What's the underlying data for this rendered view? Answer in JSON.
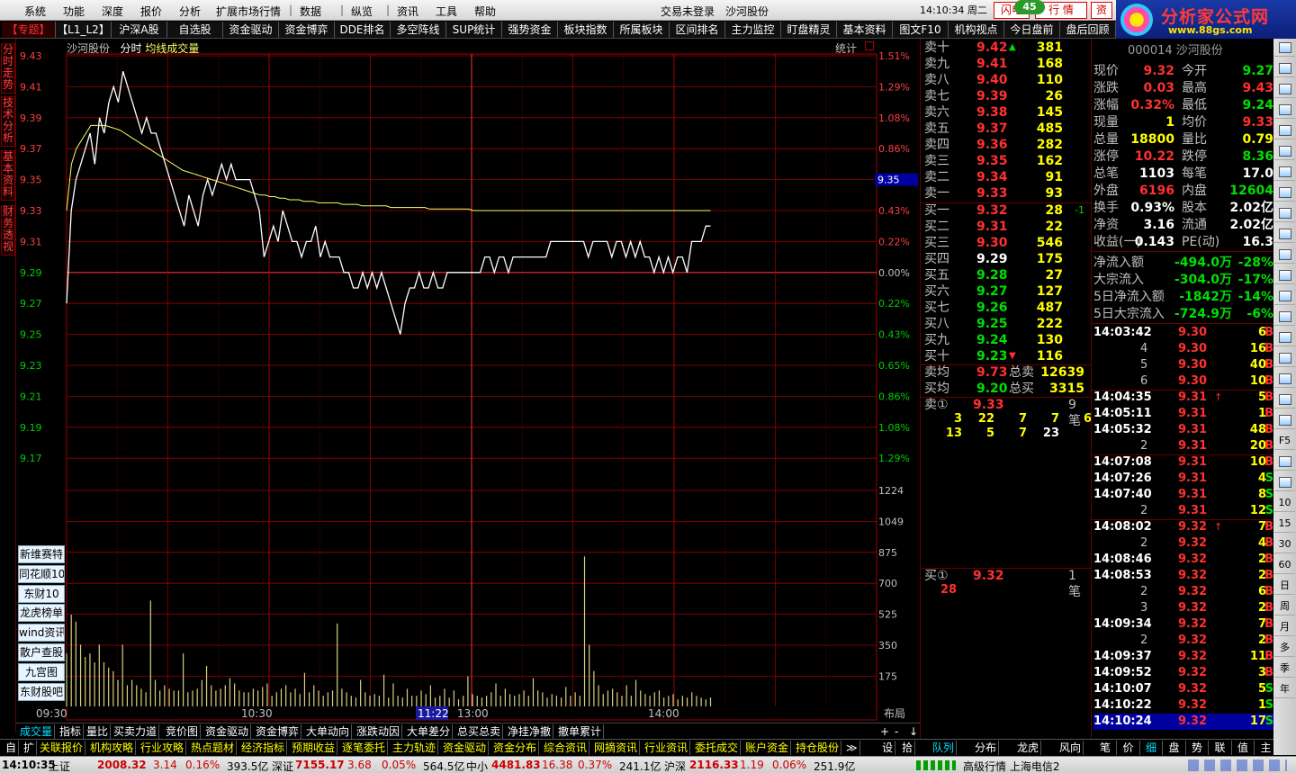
{
  "menu": [
    "系统",
    "功能",
    "深度",
    "报价",
    "分析",
    "扩展市场行情",
    "数据",
    "纵览",
    "资讯",
    "工具",
    "帮助"
  ],
  "menu_status": "交易未登录",
  "menu_stock": "沙河股份",
  "clock": "14:10:34 周二",
  "btn_flash": "闪电",
  "btn_quote": "行 情",
  "btn_capital": "资",
  "badge": "45",
  "logo_title": "分析家公式网",
  "logo_url": "www.88gs.com",
  "tabs": [
    "【专题】",
    "【L1_L2】",
    "沪深A股",
    "自选股",
    "资金驱动",
    "资金博弈",
    "DDE排名",
    "多空阵线",
    "SUP统计",
    "强势资金",
    "板块指数",
    "所属板块",
    "区间排名",
    "主力监控",
    "盯盘精灵",
    "基本资料",
    "图文F10",
    "机构视点",
    "今日盘前",
    "盘后回顾"
  ],
  "vtabs": [
    "分时走势",
    "技术分析",
    "基本资料",
    "财务透视"
  ],
  "chart": {
    "stock": "沙河股份",
    "tab_labels": "分时",
    "avg_label": "均线",
    "vol_label": "成交量",
    "stat_label": "统计",
    "price_labels": [
      "9.43",
      "9.41",
      "9.39",
      "9.37",
      "9.35",
      "9.33",
      "9.31",
      "9.29",
      "9.27",
      "9.25",
      "9.23",
      "9.21",
      "9.19",
      "9.17"
    ],
    "pct_labels": [
      "1.51%",
      "1.29%",
      "1.08%",
      "0.86%",
      "0.65%",
      "0.43%",
      "0.22%",
      "0.00%",
      "0.22%",
      "0.43%",
      "0.65%",
      "0.86%",
      "1.08%",
      "1.29%"
    ],
    "vol_labels": [
      "1224",
      "1049",
      "875",
      "700",
      "525",
      "350",
      "175"
    ],
    "current_price_tag": "9.35",
    "time_labels": [
      "09:30",
      "10:30",
      "11:22",
      "13:00",
      "14:00"
    ],
    "layout_label": "布局",
    "side_buttons": [
      "新维赛特",
      "同花顺10",
      "东财10",
      "龙虎榜单",
      "wind资讯",
      "散户查股",
      "九宫图",
      "东财股吧"
    ]
  },
  "chart_data": {
    "type": "line",
    "title": "沙河股份 分时",
    "prev_close": 9.29,
    "ylim": [
      9.16,
      9.44
    ],
    "x_range": [
      "09:30",
      "15:00"
    ],
    "series": [
      {
        "name": "price",
        "values": [
          9.27,
          9.33,
          9.35,
          9.36,
          9.37,
          9.38,
          9.36,
          9.39,
          9.38,
          9.4,
          9.41,
          9.4,
          9.42,
          9.41,
          9.4,
          9.39,
          9.38,
          9.39,
          9.38,
          9.38,
          9.37,
          9.36,
          9.35,
          9.34,
          9.33,
          9.32,
          9.34,
          9.33,
          9.32,
          9.34,
          9.35,
          9.34,
          9.35,
          9.36,
          9.35,
          9.36,
          9.35,
          9.35,
          9.35,
          9.35,
          9.34,
          9.33,
          9.3,
          9.31,
          9.32,
          9.31,
          9.33,
          9.32,
          9.31,
          9.31,
          9.3,
          9.31,
          9.31,
          9.32,
          9.3,
          9.31,
          9.3,
          9.3,
          9.3,
          9.29,
          9.29,
          9.28,
          9.28,
          9.29,
          9.28,
          9.29,
          9.28,
          9.29,
          9.28,
          9.27,
          9.26,
          9.25,
          9.27,
          9.28,
          9.28,
          9.29,
          9.28,
          9.28,
          9.29,
          9.28,
          9.28,
          9.29,
          9.29,
          9.29,
          9.29,
          9.29,
          9.29,
          9.29,
          9.29,
          9.3,
          9.3,
          9.29,
          9.3,
          9.3,
          9.29,
          9.3,
          9.3,
          9.3,
          9.3,
          9.3,
          9.3,
          9.3,
          9.3,
          9.31,
          9.31,
          9.31,
          9.31,
          9.31,
          9.31,
          9.31,
          9.31,
          9.3,
          9.31,
          9.31,
          9.31,
          9.31,
          9.3,
          9.31,
          9.31,
          9.3,
          9.31,
          9.3,
          9.31,
          9.3,
          9.3,
          9.29,
          9.3,
          9.29,
          9.3,
          9.29,
          9.3,
          9.3,
          9.29,
          9.31,
          9.31,
          9.31,
          9.32,
          9.32
        ]
      },
      {
        "name": "avg",
        "values": [
          9.33,
          9.36,
          9.37,
          9.375,
          9.38,
          9.385,
          9.385,
          9.385,
          9.385,
          9.384,
          9.383,
          9.382,
          9.38,
          9.378,
          9.376,
          9.374,
          9.372,
          9.37,
          9.368,
          9.366,
          9.364,
          9.362,
          9.36,
          9.358,
          9.356,
          9.355,
          9.354,
          9.353,
          9.352,
          9.351,
          9.35,
          9.349,
          9.348,
          9.347,
          9.346,
          9.345,
          9.344,
          9.343,
          9.342,
          9.341,
          9.34,
          9.34,
          9.339,
          9.339,
          9.338,
          9.338,
          9.337,
          9.337,
          9.337,
          9.336,
          9.336,
          9.336,
          9.335,
          9.335,
          9.335,
          9.335,
          9.335,
          9.334,
          9.334,
          9.334,
          9.334,
          9.333,
          9.333,
          9.333,
          9.333,
          9.333,
          9.333,
          9.332,
          9.332,
          9.332,
          9.332,
          9.332,
          9.332,
          9.332,
          9.332,
          9.331,
          9.331,
          9.331,
          9.331,
          9.331,
          9.331,
          9.331,
          9.331,
          9.331,
          9.33,
          9.33,
          9.33,
          9.33,
          9.33,
          9.33,
          9.33,
          9.33,
          9.33,
          9.33,
          9.33,
          9.33,
          9.33,
          9.33,
          9.33,
          9.33,
          9.33,
          9.33,
          9.33,
          9.33,
          9.33,
          9.33,
          9.33,
          9.33,
          9.33,
          9.33,
          9.33,
          9.33,
          9.33,
          9.33,
          9.33,
          9.33,
          9.33,
          9.33,
          9.33,
          9.33,
          9.33,
          9.33,
          9.33,
          9.33,
          9.33,
          9.33,
          9.33,
          9.33,
          9.33,
          9.33,
          9.33,
          9.33,
          9.33,
          9.33
        ]
      },
      {
        "name": "volume",
        "values": [
          300,
          520,
          480,
          350,
          280,
          300,
          250,
          350,
          250,
          220,
          200,
          150,
          350,
          120,
          150,
          120,
          100,
          80,
          600,
          150,
          90,
          120,
          100,
          90,
          90,
          300,
          80,
          90,
          100,
          150,
          230,
          120,
          90,
          100,
          120,
          160,
          130,
          90,
          80,
          80,
          100,
          90,
          110,
          130,
          60,
          80,
          100,
          120,
          80,
          100,
          70,
          190,
          80,
          120,
          90,
          60,
          80,
          90,
          470,
          100,
          80,
          60,
          50,
          150,
          80,
          60,
          70,
          60,
          180,
          50,
          130,
          60,
          50,
          100,
          60,
          60,
          90,
          70,
          120,
          50,
          60,
          100,
          50,
          90,
          40,
          60,
          170,
          70,
          60,
          50,
          60,
          80,
          130,
          60,
          100,
          70,
          60,
          70,
          90,
          60,
          160,
          90,
          80,
          50,
          70,
          60,
          50,
          110,
          60,
          80,
          60,
          850,
          350,
          200,
          120,
          70,
          90,
          100,
          80,
          60,
          120,
          60,
          150,
          90,
          70,
          60,
          80,
          90,
          50,
          60,
          70,
          40,
          60,
          50,
          80,
          60,
          50,
          40,
          50
        ]
      }
    ]
  },
  "orderbook": {
    "asks": [
      {
        "label": "卖十",
        "price": "9.42",
        "arrow": "▲",
        "vol": "381"
      },
      {
        "label": "卖九",
        "price": "9.41",
        "vol": "168"
      },
      {
        "label": "卖八",
        "price": "9.40",
        "vol": "110"
      },
      {
        "label": "卖七",
        "price": "9.39",
        "vol": "26"
      },
      {
        "label": "卖六",
        "price": "9.38",
        "vol": "145"
      },
      {
        "label": "卖五",
        "price": "9.37",
        "vol": "485"
      },
      {
        "label": "卖四",
        "price": "9.36",
        "vol": "282"
      },
      {
        "label": "卖三",
        "price": "9.35",
        "vol": "162"
      },
      {
        "label": "卖二",
        "price": "9.34",
        "vol": "91"
      },
      {
        "label": "卖一",
        "price": "9.33",
        "vol": "93"
      }
    ],
    "bids": [
      {
        "label": "买一",
        "price": "9.32",
        "vol": "28",
        "chg": "-1",
        "color": "red"
      },
      {
        "label": "买二",
        "price": "9.31",
        "vol": "22",
        "color": "red"
      },
      {
        "label": "买三",
        "price": "9.30",
        "vol": "546",
        "color": "red"
      },
      {
        "label": "买四",
        "price": "9.29",
        "vol": "175",
        "color": "white"
      },
      {
        "label": "买五",
        "price": "9.28",
        "vol": "27",
        "color": "green"
      },
      {
        "label": "买六",
        "price": "9.27",
        "vol": "127",
        "color": "green"
      },
      {
        "label": "买七",
        "price": "9.26",
        "vol": "487",
        "color": "green"
      },
      {
        "label": "买八",
        "price": "9.25",
        "vol": "222",
        "color": "green"
      },
      {
        "label": "买九",
        "price": "9.24",
        "vol": "130",
        "color": "green"
      },
      {
        "label": "买十",
        "price": "9.23",
        "arrow": "▼",
        "vol": "116",
        "color": "green"
      }
    ],
    "ask_avg_label": "卖均",
    "ask_avg": "9.73",
    "total_ask_label": "总卖",
    "total_ask": "12639",
    "bid_avg_label": "买均",
    "bid_avg": "9.20",
    "total_bid_label": "总买",
    "total_bid": "3315",
    "sell1_label": "卖①",
    "sell1_price": "9.33",
    "sell1_count": "9笔",
    "sell1_queue": [
      [
        "3",
        "22",
        "7",
        "7",
        "6"
      ],
      [
        "13",
        "5",
        "7",
        "23",
        ""
      ]
    ],
    "buy1_label": "买①",
    "buy1_price": "9.32",
    "buy1_count": "1笔",
    "buy1_queue": [
      "28"
    ],
    "bottom_tabs": [
      "队列",
      "分布",
      "龙虎",
      "风向"
    ]
  },
  "quote": {
    "code_name": "000014 沙河股份",
    "rows": [
      {
        "l1": "现价",
        "v1": "9.32",
        "c1": "red",
        "l2": "今开",
        "v2": "9.27",
        "c2": "green"
      },
      {
        "l1": "涨跌",
        "v1": "0.03",
        "c1": "red",
        "l2": "最高",
        "v2": "9.43",
        "c2": "red"
      },
      {
        "l1": "涨幅",
        "v1": "0.32%",
        "c1": "red",
        "l2": "最低",
        "v2": "9.24",
        "c2": "green"
      },
      {
        "l1": "现量",
        "v1": "1",
        "c1": "yellow",
        "l2": "均价",
        "v2": "9.33",
        "c2": "red"
      },
      {
        "l1": "总量",
        "v1": "18800",
        "c1": "yellow",
        "l2": "量比",
        "v2": "0.79",
        "c2": "yellow"
      },
      {
        "l1": "涨停",
        "v1": "10.22",
        "c1": "red",
        "l2": "跌停",
        "v2": "8.36",
        "c2": "green"
      },
      {
        "l1": "总笔",
        "v1": "1103",
        "c1": "white",
        "l2": "每笔",
        "v2": "17.0",
        "c2": "white"
      },
      {
        "l1": "外盘",
        "v1": "6196",
        "c1": "red",
        "l2": "内盘",
        "v2": "12604",
        "c2": "green"
      },
      {
        "l1": "换手",
        "v1": "0.93%",
        "c1": "white",
        "l2": "股本",
        "v2": "2.02亿",
        "c2": "white"
      },
      {
        "l1": "净资",
        "v1": "3.16",
        "c1": "white",
        "l2": "流通",
        "v2": "2.02亿",
        "c2": "white"
      },
      {
        "l1": "收益(一)",
        "v1": "0.143",
        "c1": "white",
        "l2": "PE(动)",
        "v2": "16.3",
        "c2": "white"
      }
    ],
    "flows": [
      {
        "l": "净流入额",
        "v": "-494.0万",
        "p": "-28%"
      },
      {
        "l": "大宗流入",
        "v": "-304.0万",
        "p": "-17%"
      },
      {
        "l": "5日净流入额",
        "v": "-1842万",
        "p": "-14%"
      },
      {
        "l": "5日大宗流入",
        "v": "-724.9万",
        "p": "-6%"
      }
    ],
    "ticks": [
      {
        "t": "14:03:42",
        "n": "",
        "p": "9.30",
        "v": "6",
        "bs": "B"
      },
      {
        "t": "",
        "n": "4",
        "p": "9.30",
        "v": "16",
        "bs": "B"
      },
      {
        "t": "",
        "n": "5",
        "p": "9.30",
        "v": "40",
        "bs": "B"
      },
      {
        "t": "",
        "n": "6",
        "p": "9.30",
        "v": "10",
        "bs": "B"
      },
      {
        "t": "14:04:35",
        "n": "",
        "p": "9.31",
        "a": "↑",
        "v": "5",
        "bs": "B"
      },
      {
        "t": "14:05:11",
        "n": "",
        "p": "9.31",
        "v": "1",
        "bs": "B"
      },
      {
        "t": "14:05:32",
        "n": "",
        "p": "9.31",
        "v": "48",
        "bs": "B"
      },
      {
        "t": "",
        "n": "2",
        "p": "9.31",
        "v": "20",
        "bs": "B"
      },
      {
        "t": "14:07:08",
        "n": "",
        "p": "9.31",
        "v": "10",
        "bs": "B"
      },
      {
        "t": "14:07:26",
        "n": "",
        "p": "9.31",
        "v": "4",
        "bs": "S"
      },
      {
        "t": "14:07:40",
        "n": "",
        "p": "9.31",
        "v": "8",
        "bs": "S"
      },
      {
        "t": "",
        "n": "2",
        "p": "9.31",
        "v": "12",
        "bs": "S"
      },
      {
        "t": "14:08:02",
        "n": "",
        "p": "9.32",
        "a": "↑",
        "v": "7",
        "bs": "B"
      },
      {
        "t": "",
        "n": "2",
        "p": "9.32",
        "v": "4",
        "bs": "B"
      },
      {
        "t": "14:08:46",
        "n": "",
        "p": "9.32",
        "v": "2",
        "bs": "B"
      },
      {
        "t": "14:08:53",
        "n": "",
        "p": "9.32",
        "v": "2",
        "bs": "B"
      },
      {
        "t": "",
        "n": "2",
        "p": "9.32",
        "v": "6",
        "bs": "B"
      },
      {
        "t": "",
        "n": "3",
        "p": "9.32",
        "v": "2",
        "bs": "B"
      },
      {
        "t": "14:09:34",
        "n": "",
        "p": "9.32",
        "v": "7",
        "bs": "B"
      },
      {
        "t": "",
        "n": "2",
        "p": "9.32",
        "v": "2",
        "bs": "B"
      },
      {
        "t": "14:09:37",
        "n": "",
        "p": "9.32",
        "v": "11",
        "bs": "B"
      },
      {
        "t": "14:09:52",
        "n": "",
        "p": "9.32",
        "v": "3",
        "bs": "B"
      },
      {
        "t": "14:10:07",
        "n": "",
        "p": "9.32",
        "v": "5",
        "bs": "S"
      },
      {
        "t": "14:10:22",
        "n": "",
        "p": "9.32",
        "v": "1",
        "bs": "S"
      },
      {
        "t": "14:10:24",
        "n": "",
        "p": "9.32",
        "v": "17",
        "bs": "S",
        "hl": true
      }
    ],
    "bottom_tabs": [
      "笔",
      "价",
      "细",
      "盘",
      "势",
      "联",
      "值",
      "主"
    ]
  },
  "rtoolbar": [
    "",
    "",
    "",
    "",
    "",
    "",
    "",
    "",
    "",
    "",
    "",
    "",
    "",
    "",
    "",
    "",
    "",
    "",
    "",
    "F5",
    "",
    "",
    "10",
    "15",
    "30",
    "60",
    "日",
    "周",
    "月",
    "多",
    "季",
    "年"
  ],
  "chart_bottom_tabs": [
    "成交量",
    "指标",
    "量比",
    "买卖力道",
    "竞价图",
    "资金驱动",
    "资金博弈",
    "大单动向",
    "涨跌动因",
    "大单差分",
    "总买总卖",
    "净挂净撤",
    "撤单累计"
  ],
  "chart_bottom_ctrl": [
    "+",
    "-",
    "↓"
  ],
  "bottom_tabs": [
    "自",
    "扩",
    "关联报价",
    "机构攻略",
    "行业攻略",
    "热点题材",
    "经济指标",
    "预期收益",
    "逐笔委托",
    "主力轨迹",
    "资金驱动",
    "资金分布",
    "综合资讯",
    "网摘资讯",
    "行业资讯",
    "委托成交",
    "账户资金",
    "持仓股份",
    "≫",
    "设",
    "拾"
  ],
  "statusbar": {
    "time": "14:10:35",
    "sh_label": "上证",
    "sh_val": "2008.32",
    "sh_chg": "3.14",
    "sh_pct": "0.16%",
    "sh_amt": "393.5亿",
    "sz_label": "深证",
    "sz_val": "7155.17",
    "sz_chg": "3.68",
    "sz_pct": "0.05%",
    "sz_amt": "564.5亿",
    "zx_label": "中小",
    "zx_val": "4481.83",
    "zx_chg": "16.38",
    "zx_pct": "0.37%",
    "zx_amt": "241.1亿",
    "hs_label": "沪深",
    "hs_val": "2116.33",
    "hs_chg": "1.19",
    "hs_pct": "0.06%",
    "hs_amt": "251.9亿",
    "server": "高级行情 上海电信2"
  }
}
